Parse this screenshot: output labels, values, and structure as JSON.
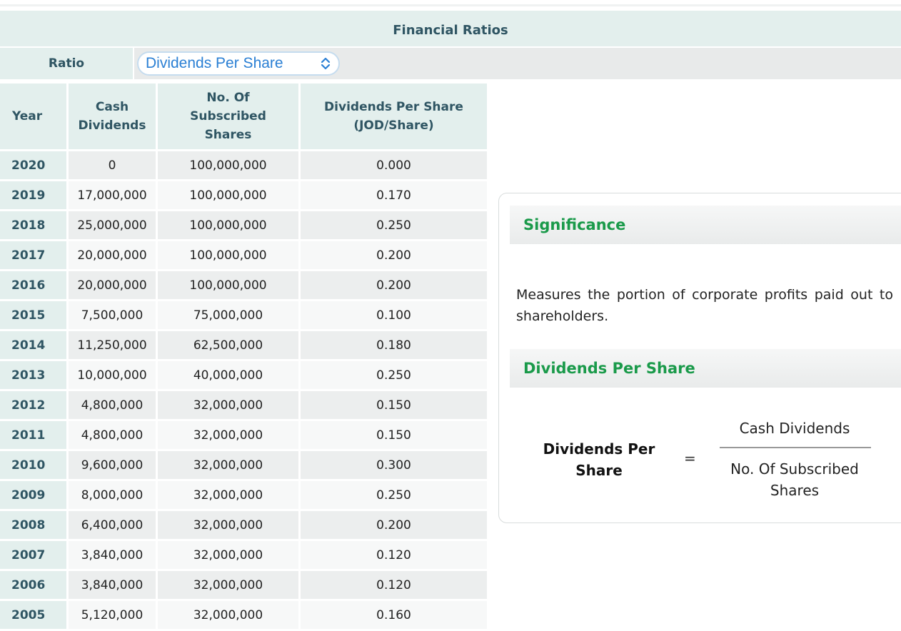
{
  "header": {
    "title": "Financial Ratios"
  },
  "ratio_selector": {
    "label": "Ratio",
    "selected": "Dividends Per Share",
    "icon": "chevron-up-down-icon"
  },
  "table": {
    "columns": [
      "Year",
      "Cash Dividends",
      "No. Of Subscribed Shares",
      "Dividends Per Share (JOD/Share)"
    ],
    "rows": [
      [
        "2020",
        "0",
        "100,000,000",
        "0.000"
      ],
      [
        "2019",
        "17,000,000",
        "100,000,000",
        "0.170"
      ],
      [
        "2018",
        "25,000,000",
        "100,000,000",
        "0.250"
      ],
      [
        "2017",
        "20,000,000",
        "100,000,000",
        "0.200"
      ],
      [
        "2016",
        "20,000,000",
        "100,000,000",
        "0.200"
      ],
      [
        "2015",
        "7,500,000",
        "75,000,000",
        "0.100"
      ],
      [
        "2014",
        "11,250,000",
        "62,500,000",
        "0.180"
      ],
      [
        "2013",
        "10,000,000",
        "40,000,000",
        "0.250"
      ],
      [
        "2012",
        "4,800,000",
        "32,000,000",
        "0.150"
      ],
      [
        "2011",
        "4,800,000",
        "32,000,000",
        "0.150"
      ],
      [
        "2010",
        "9,600,000",
        "32,000,000",
        "0.300"
      ],
      [
        "2009",
        "8,000,000",
        "32,000,000",
        "0.250"
      ],
      [
        "2008",
        "6,400,000",
        "32,000,000",
        "0.200"
      ],
      [
        "2007",
        "3,840,000",
        "32,000,000",
        "0.120"
      ],
      [
        "2006",
        "3,840,000",
        "32,000,000",
        "0.120"
      ],
      [
        "2005",
        "5,120,000",
        "32,000,000",
        "0.160"
      ]
    ]
  },
  "info_card": {
    "significance_title": "Significance",
    "significance_text": "Measures the portion of corporate profits paid out to shareholders.",
    "formula_title": "Dividends Per Share",
    "formula_lhs": "Dividends Per Share",
    "formula_eq": "=",
    "formula_numerator": "Cash Dividends",
    "formula_denominator": "No. Of Subscribed Shares"
  },
  "colors": {
    "header_bg": "#e3efed",
    "header_text": "#2f5563",
    "accent_green": "#1a9a4a",
    "select_text": "#2a7fd4"
  }
}
